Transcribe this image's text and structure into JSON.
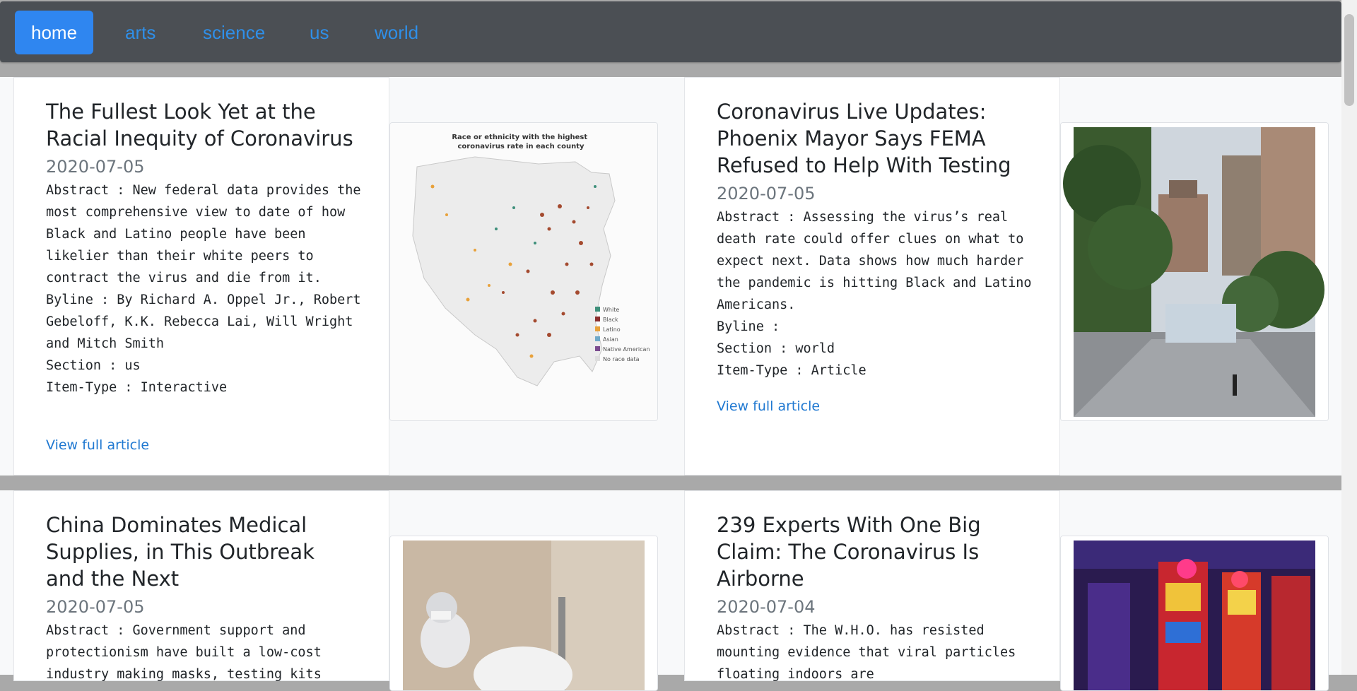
{
  "nav": {
    "items": [
      {
        "label": "home",
        "active": true
      },
      {
        "label": "arts",
        "active": false
      },
      {
        "label": "science",
        "active": false
      },
      {
        "label": "us",
        "active": false
      },
      {
        "label": "world",
        "active": false
      }
    ]
  },
  "articles": [
    {
      "title": "The Fullest Look Yet at the Racial Inequity of Coronavirus",
      "date": "2020-07-05",
      "abstract": "Abstract : New federal data provides the most comprehensive view to date of how Black and Latino people have been likelier than their white peers to contract the virus and die from it.",
      "byline": "Byline : By Richard A. Oppel Jr., Robert Gebeloff, K.K. Rebecca Lai, Will Wright and Mitch Smith",
      "section": "Section : us",
      "item_type": "Item-Type : Interactive",
      "link": "View full article",
      "image": {
        "title_text": "Race or ethnicity with the highest coronavirus rate in each county",
        "legend": [
          "White",
          "Black",
          "Latino",
          "Asian",
          "Native American",
          "No race data"
        ],
        "legend_colors": [
          "#3d8f7a",
          "#8b2e2e",
          "#e8a13a",
          "#6fa9c9",
          "#7a4b8f",
          "#dddddd"
        ]
      }
    },
    {
      "title": "Coronavirus Live Updates: Phoenix Mayor Says FEMA Refused to Help With Testing",
      "date": "2020-07-05",
      "abstract": "Abstract : Assessing the virus’s real death rate could offer clues on what to expect next. Data shows how much harder the pandemic is hitting Black and Latino Americans.",
      "byline": "Byline :",
      "section": "Section : world",
      "item_type": "Item-Type : Article",
      "link": "View full article"
    },
    {
      "title": "China Dominates Medical Supplies, in This Outbreak and the Next",
      "date": "2020-07-05",
      "abstract": "Abstract : Government support and protectionism have built a low-cost industry making masks, testing kits"
    },
    {
      "title": "239 Experts With One Big Claim: The Coronavirus Is Airborne",
      "date": "2020-07-04",
      "abstract": "Abstract : The W.H.O. has resisted mounting evidence that viral particles floating indoors are"
    }
  ]
}
